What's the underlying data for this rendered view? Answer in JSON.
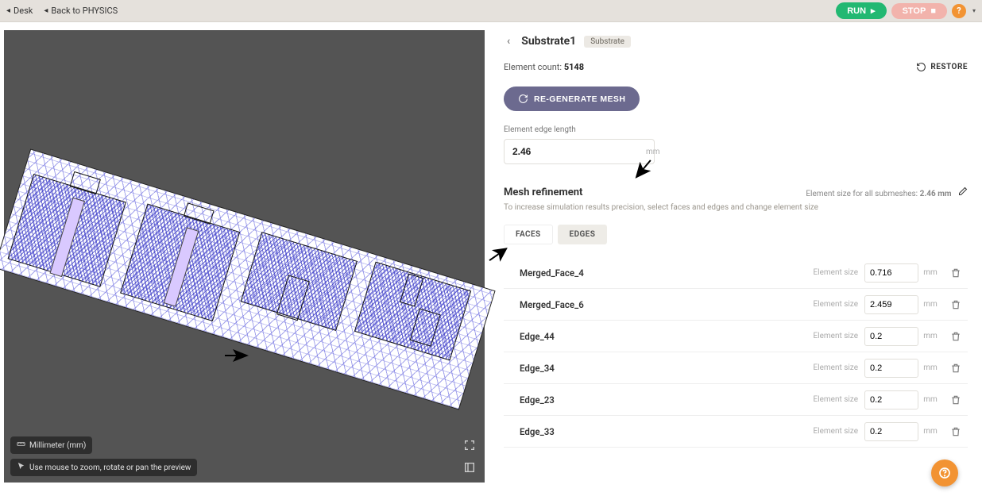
{
  "topbar": {
    "desk": "Desk",
    "back": "Back to PHYSICS",
    "run": "RUN",
    "stop": "STOP"
  },
  "viewport": {
    "units_label": "Millimeter (mm)",
    "hint": "Use mouse to zoom, rotate or pan the preview"
  },
  "panel": {
    "title": "Substrate1",
    "badge": "Substrate",
    "element_count_label": "Element count:",
    "element_count": "5148",
    "restore": "RESTORE",
    "regenerate": "RE-GENERATE MESH",
    "edge_length_label": "Element edge length",
    "edge_length_value": "2.46",
    "edge_length_unit": "mm",
    "refinement_title": "Mesh refinement",
    "submesh_note_prefix": "Element size for all submeshes: ",
    "submesh_note_value": "2.46 mm",
    "help_text": "To increase simulation results precision, select faces and edges and change element size",
    "tabs": {
      "faces": "FACES",
      "edges": "EDGES",
      "active": "edges"
    },
    "rows": [
      {
        "name": "Merged_Face_4",
        "size": "0.716",
        "unit": "mm"
      },
      {
        "name": "Merged_Face_6",
        "size": "2.459",
        "unit": "mm"
      },
      {
        "name": "Edge_44",
        "size": "0.2",
        "unit": "mm"
      },
      {
        "name": "Edge_34",
        "size": "0.2",
        "unit": "mm"
      },
      {
        "name": "Edge_23",
        "size": "0.2",
        "unit": "mm"
      },
      {
        "name": "Edge_33",
        "size": "0.2",
        "unit": "mm"
      }
    ],
    "row_label": "Element size"
  }
}
